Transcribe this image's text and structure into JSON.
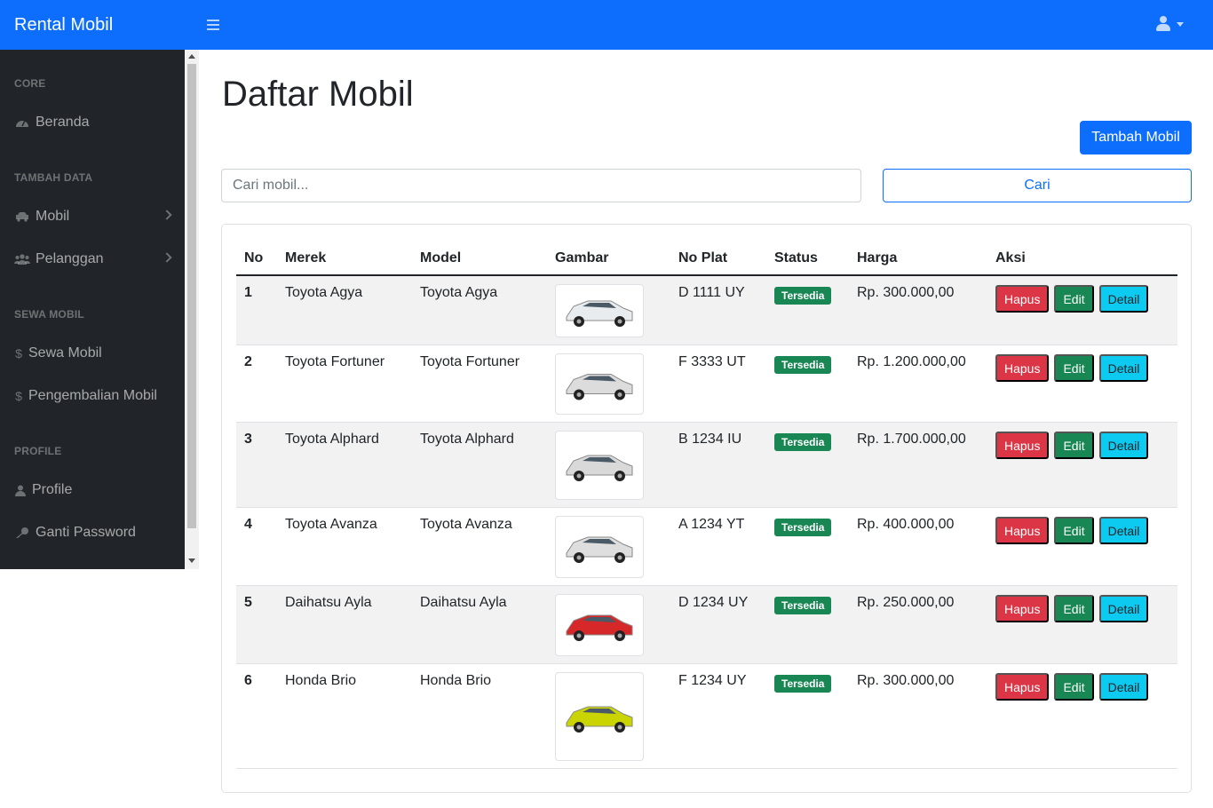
{
  "app": {
    "brand": "Rental Mobil"
  },
  "sidebar": {
    "sections": [
      {
        "heading": "CORE",
        "items": [
          {
            "label": "Beranda",
            "icon": "dashboard-icon"
          }
        ]
      },
      {
        "heading": "TAMBAH DATA",
        "items": [
          {
            "label": "Mobil",
            "icon": "car-icon",
            "has_submenu": true
          },
          {
            "label": "Pelanggan",
            "icon": "users-icon",
            "has_submenu": true
          }
        ]
      },
      {
        "heading": "SEWA MOBIL",
        "items": [
          {
            "label": "Sewa Mobil",
            "icon": "dollar-icon"
          },
          {
            "label": "Pengembalian Mobil",
            "icon": "dollar-icon"
          }
        ]
      },
      {
        "heading": "PROFILE",
        "items": [
          {
            "label": "Profile",
            "icon": "user-icon"
          },
          {
            "label": "Ganti Password",
            "icon": "key-icon"
          }
        ]
      }
    ]
  },
  "main": {
    "title": "Daftar Mobil",
    "add_button": "Tambah Mobil",
    "search": {
      "placeholder": "Cari mobil...",
      "value": "",
      "button": "Cari"
    },
    "table": {
      "headers": [
        "No",
        "Merek",
        "Model",
        "Gambar",
        "No Plat",
        "Status",
        "Harga",
        "Aksi"
      ],
      "actions": {
        "delete": "Hapus",
        "edit": "Edit",
        "detail": "Detail"
      },
      "rows": [
        {
          "no": "1",
          "merek": "Toyota Agya",
          "model": "Toyota Agya",
          "image": "car-image-white-hatchback",
          "plat": "D 1111 UY",
          "status": "Tersedia",
          "harga": "Rp. 300.000,00"
        },
        {
          "no": "2",
          "merek": "Toyota Fortuner",
          "model": "Toyota Fortuner",
          "image": "car-image-white-suv",
          "plat": "F 3333 UT",
          "status": "Tersedia",
          "harga": "Rp. 1.200.000,00"
        },
        {
          "no": "3",
          "merek": "Toyota Alphard",
          "model": "Toyota Alphard",
          "image": "car-image-white-van",
          "plat": "B 1234 IU",
          "status": "Tersedia",
          "harga": "Rp. 1.700.000,00"
        },
        {
          "no": "4",
          "merek": "Toyota Avanza",
          "model": "Toyota Avanza",
          "image": "car-image-white-mpv",
          "plat": "A 1234 YT",
          "status": "Tersedia",
          "harga": "Rp. 400.000,00"
        },
        {
          "no": "5",
          "merek": "Daihatsu Ayla",
          "model": "Daihatsu Ayla",
          "image": "car-image-red-hatchback",
          "plat": "D 1234 UY",
          "status": "Tersedia",
          "harga": "Rp. 250.000,00"
        },
        {
          "no": "6",
          "merek": "Honda Brio",
          "model": "Honda Brio",
          "image": "car-image-yellow-hatchback",
          "plat": "F 1234 UY",
          "status": "Tersedia",
          "harga": "Rp. 300.000,00"
        }
      ]
    }
  },
  "colors": {
    "primary": "#0d6efd",
    "sidebar": "#212529",
    "danger": "#dc3545",
    "success": "#198754",
    "info": "#0dcaf0"
  }
}
